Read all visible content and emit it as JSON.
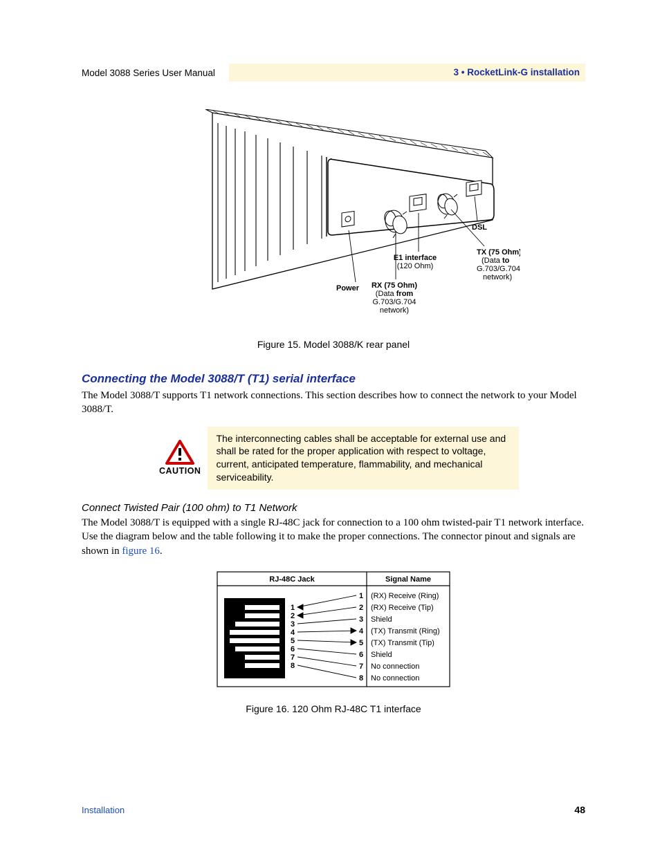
{
  "header": {
    "left": "Model 3088 Series User Manual",
    "right": "3 • RocketLink-G installation"
  },
  "figure15": {
    "caption": "Figure 15. Model 3088/K rear panel",
    "labels": {
      "dsl": "DSL",
      "tx": "TX (75 Ohm)",
      "tx_paren_open": "(Data ",
      "tx_bold": "to",
      "tx_line2": "G.703/G.704",
      "tx_line3": "network)",
      "e1_line1": "E1 interface",
      "e1_line2": "(120 Ohm)",
      "rx": "RX (75 Ohm)",
      "rx_paren_open": "(Data ",
      "rx_bold": "from",
      "rx_line2": "G.703/G.704",
      "rx_line3": "network)",
      "power": "Power"
    }
  },
  "section": {
    "heading": "Connecting the Model 3088/T (T1) serial interface",
    "para1": "The Model 3088/T supports T1 network connections. This section describes how to connect the network to your Model 3088/T."
  },
  "caution": {
    "label": "CAUTION",
    "text": "The interconnecting cables shall be acceptable for external use and shall be rated for the proper application with respect to voltage, current, anticipated temperature, flammability, and mechanical serviceability."
  },
  "subsection": {
    "heading": "Connect Twisted Pair (100 ohm) to T1 Network",
    "para_prefix": "The Model 3088/T is equipped with a single RJ-48C jack for connection to a 100 ohm twisted-pair T1 network interface. Use the diagram below and the table following it to make the proper connections. The connector pinout and signals are shown in ",
    "para_link": "figure 16",
    "para_suffix": "."
  },
  "figure16": {
    "caption": "Figure 16. 120 Ohm RJ-48C T1 interface",
    "table_headers": {
      "left": "RJ-48C Jack",
      "right": "Signal Name"
    },
    "signals": [
      "(RX) Receive (Ring)",
      "(RX) Receive (Tip)",
      "Shield",
      "(TX) Transmit (Ring)",
      "(TX) Transmit (Tip)",
      "Shield",
      "No connection",
      "No connection"
    ],
    "pins": [
      "1",
      "2",
      "3",
      "4",
      "5",
      "6",
      "7",
      "8"
    ]
  },
  "footer": {
    "left": "Installation",
    "page": "48"
  }
}
